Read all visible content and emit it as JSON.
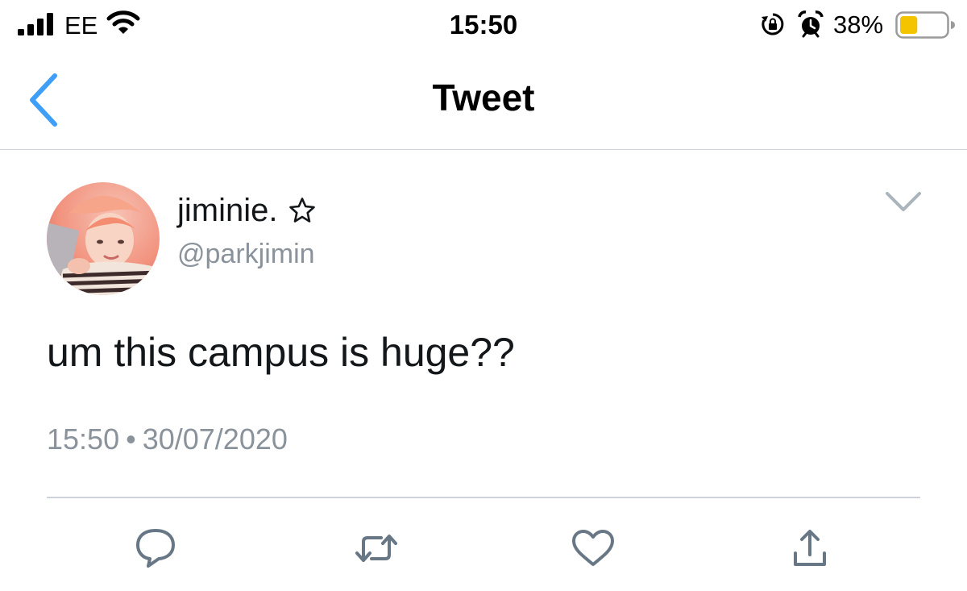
{
  "status_bar": {
    "carrier": "EE",
    "time": "15:50",
    "battery_percent": "38%",
    "battery_level": 0.38,
    "battery_color": "#f5c400",
    "icons": [
      "signal-icon",
      "wifi-icon",
      "rotation-lock-icon",
      "alarm-icon",
      "battery-icon"
    ]
  },
  "nav": {
    "title": "Tweet",
    "back_icon": "chevron-left-icon",
    "accent": "#3f9ef5"
  },
  "tweet": {
    "display_name": "jiminie.",
    "name_icon": "star-outline-icon",
    "handle": "@parkjimin",
    "text": "um this campus is huge??",
    "time": "15:50",
    "separator": "•",
    "date": "30/07/2020",
    "menu_icon": "chevron-down-icon"
  },
  "actions": {
    "icons": [
      "reply-icon",
      "retweet-icon",
      "like-icon",
      "share-icon"
    ],
    "color": "#687785"
  }
}
